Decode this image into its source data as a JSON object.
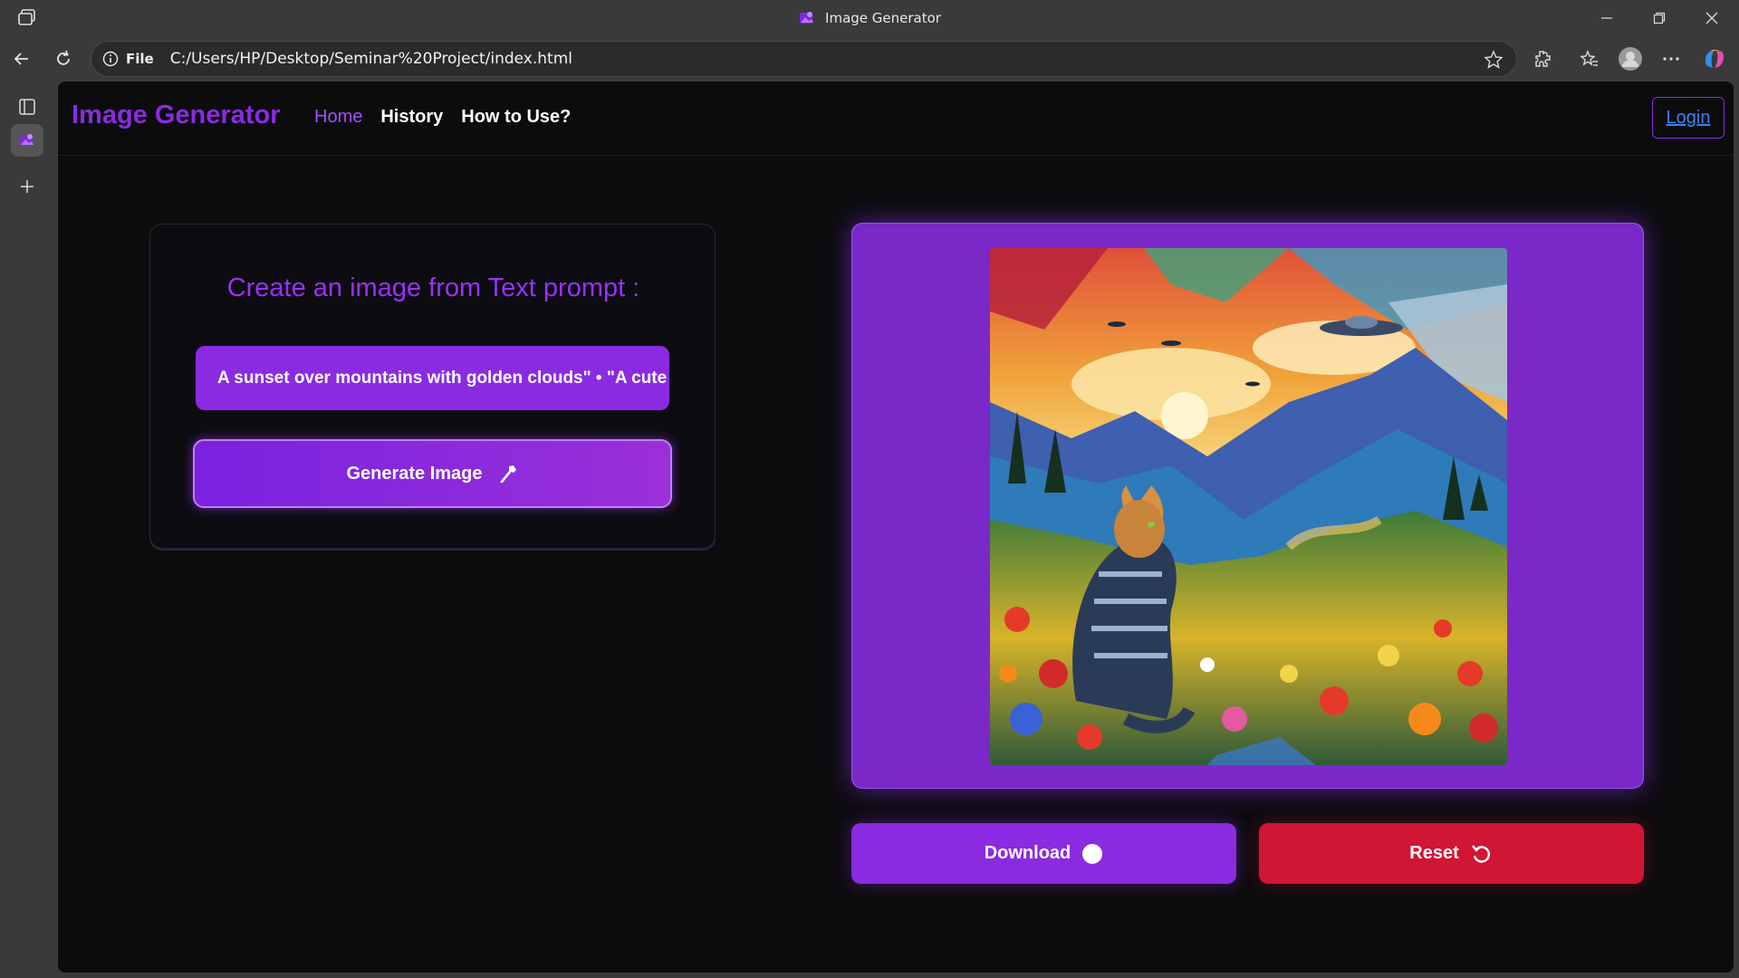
{
  "browser": {
    "window_title": "Image Generator",
    "address": {
      "scheme_label": "File",
      "url": "C:/Users/HP/Desktop/Seminar%20Project/index.html"
    }
  },
  "app": {
    "brand": "Image Generator",
    "nav": [
      {
        "label": "Home",
        "active": true
      },
      {
        "label": "History",
        "active": false
      },
      {
        "label": "How to Use?",
        "active": false
      }
    ],
    "login_label": "Login",
    "prompt_card": {
      "title": "Create an image from Text prompt :",
      "prompt_value": "A sunset over mountains with golden clouds\" • \"A cute",
      "generate_label": "Generate Image",
      "generate_icon": "magic-wand-icon"
    },
    "result": {
      "image_description_icon": "generated-image",
      "download_label": "Download",
      "download_icon": "circle-icon",
      "reset_label": "Reset",
      "reset_icon": "rotate-icon"
    }
  },
  "colors": {
    "accent": "#8a2be2",
    "danger": "#d11534",
    "background": "#0c0c0d",
    "link": "#3b82f6"
  }
}
